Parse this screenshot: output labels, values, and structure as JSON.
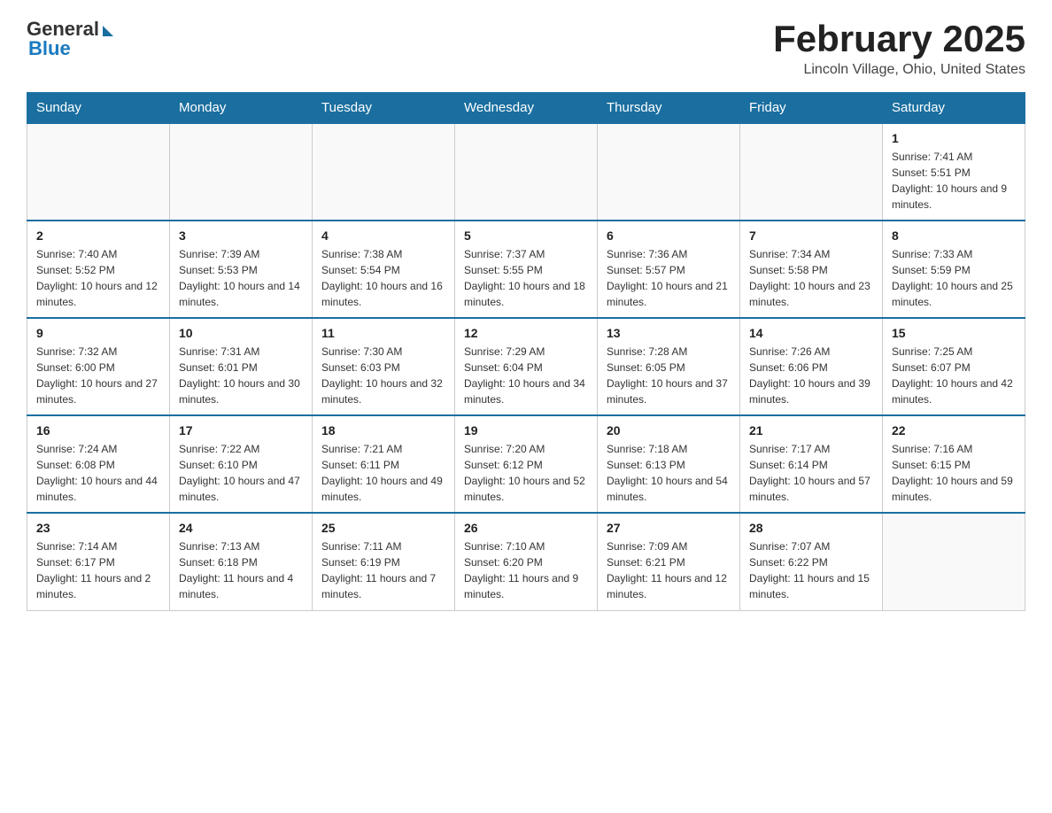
{
  "header": {
    "logo_general": "General",
    "logo_blue": "Blue",
    "month_title": "February 2025",
    "location": "Lincoln Village, Ohio, United States"
  },
  "days_of_week": [
    "Sunday",
    "Monday",
    "Tuesday",
    "Wednesday",
    "Thursday",
    "Friday",
    "Saturday"
  ],
  "weeks": [
    [
      {
        "day": "",
        "info": ""
      },
      {
        "day": "",
        "info": ""
      },
      {
        "day": "",
        "info": ""
      },
      {
        "day": "",
        "info": ""
      },
      {
        "day": "",
        "info": ""
      },
      {
        "day": "",
        "info": ""
      },
      {
        "day": "1",
        "info": "Sunrise: 7:41 AM\nSunset: 5:51 PM\nDaylight: 10 hours and 9 minutes."
      }
    ],
    [
      {
        "day": "2",
        "info": "Sunrise: 7:40 AM\nSunset: 5:52 PM\nDaylight: 10 hours and 12 minutes."
      },
      {
        "day": "3",
        "info": "Sunrise: 7:39 AM\nSunset: 5:53 PM\nDaylight: 10 hours and 14 minutes."
      },
      {
        "day": "4",
        "info": "Sunrise: 7:38 AM\nSunset: 5:54 PM\nDaylight: 10 hours and 16 minutes."
      },
      {
        "day": "5",
        "info": "Sunrise: 7:37 AM\nSunset: 5:55 PM\nDaylight: 10 hours and 18 minutes."
      },
      {
        "day": "6",
        "info": "Sunrise: 7:36 AM\nSunset: 5:57 PM\nDaylight: 10 hours and 21 minutes."
      },
      {
        "day": "7",
        "info": "Sunrise: 7:34 AM\nSunset: 5:58 PM\nDaylight: 10 hours and 23 minutes."
      },
      {
        "day": "8",
        "info": "Sunrise: 7:33 AM\nSunset: 5:59 PM\nDaylight: 10 hours and 25 minutes."
      }
    ],
    [
      {
        "day": "9",
        "info": "Sunrise: 7:32 AM\nSunset: 6:00 PM\nDaylight: 10 hours and 27 minutes."
      },
      {
        "day": "10",
        "info": "Sunrise: 7:31 AM\nSunset: 6:01 PM\nDaylight: 10 hours and 30 minutes."
      },
      {
        "day": "11",
        "info": "Sunrise: 7:30 AM\nSunset: 6:03 PM\nDaylight: 10 hours and 32 minutes."
      },
      {
        "day": "12",
        "info": "Sunrise: 7:29 AM\nSunset: 6:04 PM\nDaylight: 10 hours and 34 minutes."
      },
      {
        "day": "13",
        "info": "Sunrise: 7:28 AM\nSunset: 6:05 PM\nDaylight: 10 hours and 37 minutes."
      },
      {
        "day": "14",
        "info": "Sunrise: 7:26 AM\nSunset: 6:06 PM\nDaylight: 10 hours and 39 minutes."
      },
      {
        "day": "15",
        "info": "Sunrise: 7:25 AM\nSunset: 6:07 PM\nDaylight: 10 hours and 42 minutes."
      }
    ],
    [
      {
        "day": "16",
        "info": "Sunrise: 7:24 AM\nSunset: 6:08 PM\nDaylight: 10 hours and 44 minutes."
      },
      {
        "day": "17",
        "info": "Sunrise: 7:22 AM\nSunset: 6:10 PM\nDaylight: 10 hours and 47 minutes."
      },
      {
        "day": "18",
        "info": "Sunrise: 7:21 AM\nSunset: 6:11 PM\nDaylight: 10 hours and 49 minutes."
      },
      {
        "day": "19",
        "info": "Sunrise: 7:20 AM\nSunset: 6:12 PM\nDaylight: 10 hours and 52 minutes."
      },
      {
        "day": "20",
        "info": "Sunrise: 7:18 AM\nSunset: 6:13 PM\nDaylight: 10 hours and 54 minutes."
      },
      {
        "day": "21",
        "info": "Sunrise: 7:17 AM\nSunset: 6:14 PM\nDaylight: 10 hours and 57 minutes."
      },
      {
        "day": "22",
        "info": "Sunrise: 7:16 AM\nSunset: 6:15 PM\nDaylight: 10 hours and 59 minutes."
      }
    ],
    [
      {
        "day": "23",
        "info": "Sunrise: 7:14 AM\nSunset: 6:17 PM\nDaylight: 11 hours and 2 minutes."
      },
      {
        "day": "24",
        "info": "Sunrise: 7:13 AM\nSunset: 6:18 PM\nDaylight: 11 hours and 4 minutes."
      },
      {
        "day": "25",
        "info": "Sunrise: 7:11 AM\nSunset: 6:19 PM\nDaylight: 11 hours and 7 minutes."
      },
      {
        "day": "26",
        "info": "Sunrise: 7:10 AM\nSunset: 6:20 PM\nDaylight: 11 hours and 9 minutes."
      },
      {
        "day": "27",
        "info": "Sunrise: 7:09 AM\nSunset: 6:21 PM\nDaylight: 11 hours and 12 minutes."
      },
      {
        "day": "28",
        "info": "Sunrise: 7:07 AM\nSunset: 6:22 PM\nDaylight: 11 hours and 15 minutes."
      },
      {
        "day": "",
        "info": ""
      }
    ]
  ]
}
